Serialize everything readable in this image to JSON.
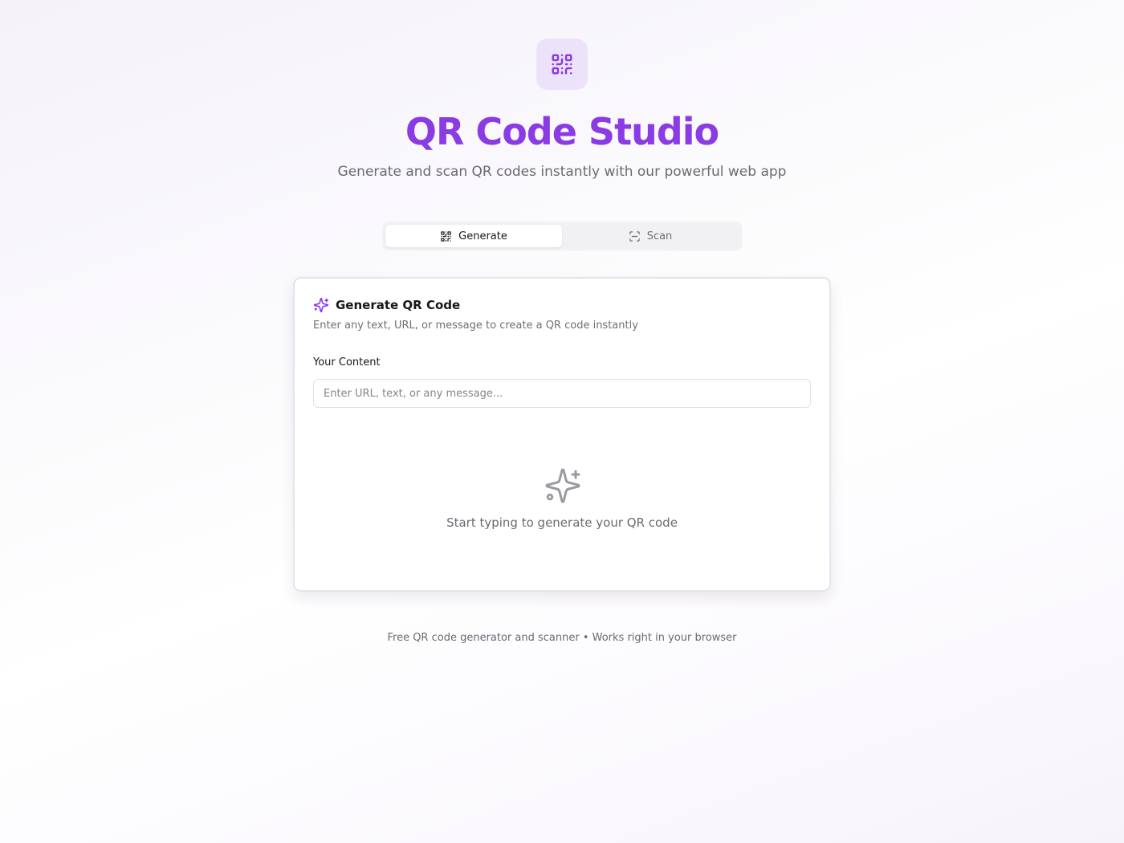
{
  "header": {
    "logo_icon": "qr-code-icon",
    "title": "QR Code Studio",
    "subtitle": "Generate and scan QR codes instantly with our powerful web app"
  },
  "tabs": [
    {
      "label": "Generate",
      "icon": "qr-code-icon",
      "active": true
    },
    {
      "label": "Scan",
      "icon": "scan-icon",
      "active": false
    }
  ],
  "generator": {
    "icon": "sparkles-icon",
    "title": "Generate QR Code",
    "description": "Enter any text, URL, or message to create a QR code instantly",
    "field_label": "Your Content",
    "input_value": "",
    "input_placeholder": "Enter URL, text, or any message...",
    "empty_icon": "sparkles-icon",
    "empty_state": "Start typing to generate your QR code"
  },
  "footer": {
    "text": "Free QR code generator and scanner • Works right in your browser"
  },
  "colors": {
    "accent": "#8a3be3",
    "logo_tile": "#ece3fb",
    "muted_text": "#6a6a72"
  }
}
